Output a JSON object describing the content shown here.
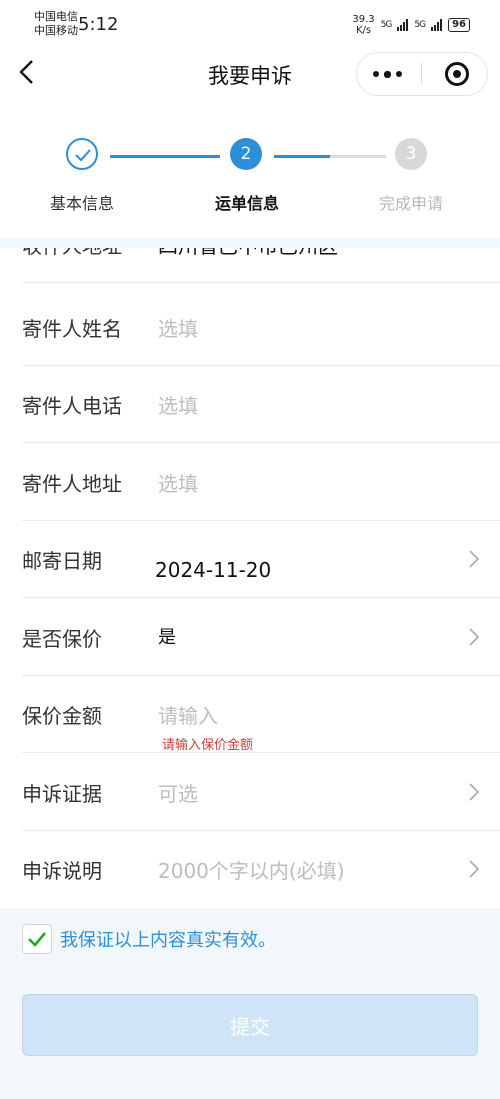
{
  "status_bar": {
    "carrier_1": "中国电信",
    "carrier_2": "中国移动",
    "time": "5:12",
    "speed_value": "39.3",
    "speed_unit": "K/s",
    "sig1": "5G",
    "sig2": "5G",
    "battery": "96"
  },
  "nav": {
    "title": "我要申诉",
    "more_icon": "more-dots-icon",
    "close_icon": "target-circle-icon"
  },
  "steps": [
    {
      "number": "1",
      "label": "基本信息",
      "state": "done"
    },
    {
      "number": "2",
      "label": "运单信息",
      "state": "active"
    },
    {
      "number": "3",
      "label": "完成申请",
      "state": "pending"
    }
  ],
  "colors": {
    "accent": "#2d8fd9",
    "error": "#d23a3a",
    "placeholder": "#bdbdbd"
  },
  "form": {
    "cut_row": {
      "label": "收件人地址",
      "value": "四川省巴中市巴州区"
    },
    "sender_name": {
      "label": "寄件人姓名",
      "placeholder": "选填"
    },
    "sender_phone": {
      "label": "寄件人电话",
      "placeholder": "选填"
    },
    "sender_address": {
      "label": "寄件人地址",
      "placeholder": "选填"
    },
    "mail_date": {
      "label": "邮寄日期",
      "value": "2024-11-20"
    },
    "insured": {
      "label": "是否保价",
      "value": "是"
    },
    "insured_amount": {
      "label": "保价金额",
      "placeholder": "请输入",
      "error": "请输入保价金额"
    },
    "evidence": {
      "label": "申诉证据",
      "placeholder": "可选"
    },
    "description": {
      "label": "申诉说明",
      "placeholder": "2000个字以内(必填)"
    }
  },
  "agreement": {
    "text": "我保证以上内容真实有效。",
    "checked": true
  },
  "submit": {
    "label": "提交"
  }
}
